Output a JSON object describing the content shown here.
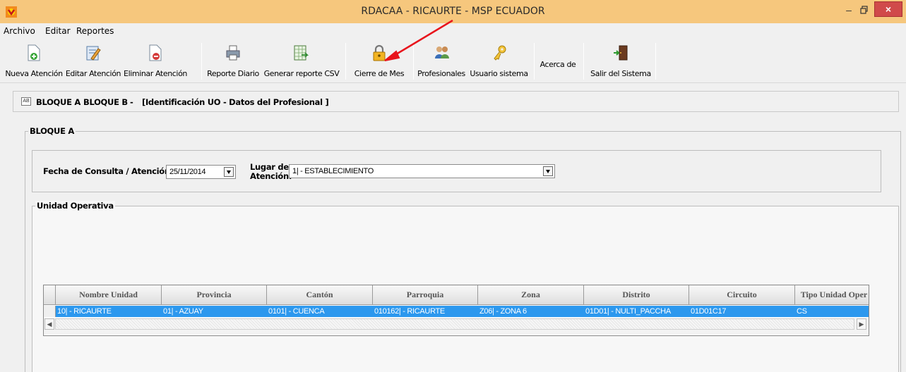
{
  "window": {
    "title": "RDACAA - RICAURTE - MSP ECUADOR",
    "min_glyph": "–",
    "close_glyph": "×"
  },
  "menu": [
    "Archivo",
    "Editar",
    "Reportes"
  ],
  "toolbar": {
    "nueva": "Nueva Atención",
    "editar": "Editar Atención",
    "eliminar": "Eliminar Atención",
    "reporte_diario": "Reporte Diario",
    "csv": "Generar reporte CSV",
    "cierre": "Cierre de Mes",
    "profesionales": "Profesionales",
    "usuario": "Usuario sistema",
    "acerca": "Acerca de",
    "salir": "Salir del Sistema"
  },
  "header": {
    "icon_text": "AB",
    "bloque_a": "BLOQUE A",
    "bloque_b": "BLOQUE B",
    "dash": "-",
    "desc": "[Identificación UO - Datos del Profesional ]"
  },
  "bloque_a": {
    "title": "BLOQUE A",
    "fecha_label": "Fecha de Consulta / Atención:",
    "fecha_value": "25/11/2014",
    "lugar_label_1": "Lugar de",
    "lugar_label_2": "Atención:",
    "lugar_value": "1| - ESTABLECIMIENTO"
  },
  "unidad": {
    "title": "Unidad Operativa",
    "columns": [
      "Nombre Unidad",
      "Provincia",
      "Cantón",
      "Parroquia",
      "Zona",
      "Distrito",
      "Circuito",
      "Tipo Unidad Oper"
    ],
    "rows": [
      [
        "10| - RICAURTE",
        "01| - AZUAY",
        "0101| - CUENCA",
        "010162| - RICAURTE",
        "Z06| - ZONA 6",
        "01D01| - NULTI_PACCHA",
        "01D01C17",
        "CS"
      ]
    ]
  },
  "colors": {
    "titlebar": "#f6c77d",
    "selection": "#2c98ee",
    "annotation_arrow": "#e8141c"
  }
}
